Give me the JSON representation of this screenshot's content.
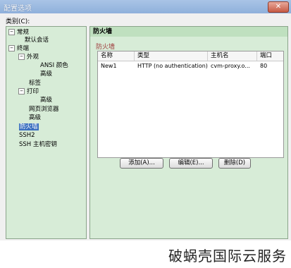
{
  "window": {
    "title": "配置选项",
    "close_glyph": "✕"
  },
  "category_label": "类别(C):",
  "tree": [
    {
      "label": "常规",
      "expander": "−"
    },
    {
      "label": "默认会话",
      "expander": ""
    },
    {
      "label": "终端",
      "expander": "−"
    },
    {
      "label": "外观",
      "expander": "−"
    },
    {
      "label": "ANSI 颜色",
      "expander": ""
    },
    {
      "label": "高级",
      "expander": ""
    },
    {
      "label": "标签",
      "expander": ""
    },
    {
      "label": "打印",
      "expander": "−"
    },
    {
      "label": "高级",
      "expander": ""
    },
    {
      "label": "网页浏览器",
      "expander": ""
    },
    {
      "label": "高级",
      "expander": ""
    },
    {
      "label": "防火墙",
      "expander": "",
      "selected": true
    },
    {
      "label": "SSH2",
      "expander": ""
    },
    {
      "label": "SSH 主机密钥",
      "expander": ""
    }
  ],
  "panel": {
    "header": "防火墙",
    "section_title": "防火墙",
    "columns": [
      "名称",
      "类型",
      "主机名",
      "端口"
    ],
    "rows": [
      {
        "name": "New1",
        "type": "HTTP (no authentication)",
        "host": "cvm-proxy.o...",
        "port": "80"
      }
    ],
    "buttons": {
      "add": "添加(A)...",
      "edit": "编辑(E)...",
      "delete": "删除(D)"
    }
  },
  "watermark": "破蜗壳国际云服务"
}
